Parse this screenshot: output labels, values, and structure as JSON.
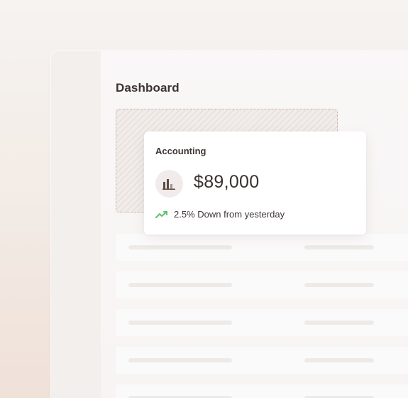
{
  "dashboard": {
    "title": "Dashboard"
  },
  "stat_card": {
    "title": "Accounting",
    "amount": "$89,000",
    "icon": "bar-chart-icon",
    "trend_icon": "trending-up-icon",
    "trend_text": "2.5% Down from yesterday"
  },
  "colors": {
    "trend_green": "#5cc26b",
    "icon_brown": "#5b4b45"
  },
  "table": {
    "rows": [
      1,
      2,
      3,
      4,
      5
    ]
  }
}
